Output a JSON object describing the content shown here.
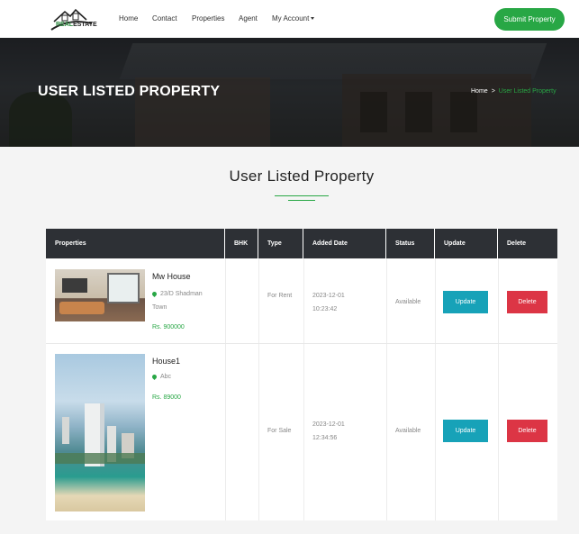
{
  "header": {
    "logo_text_green": "REAL",
    "logo_text_dark": "ESTATE",
    "nav": [
      "Home",
      "Contact",
      "Properties",
      "Agent",
      "My Account"
    ],
    "submit_label": "Submit Property"
  },
  "hero": {
    "title": "USER LISTED PROPERTY",
    "breadcrumb_home": "Home",
    "breadcrumb_sep": ">",
    "breadcrumb_current": "User Listed Property"
  },
  "section": {
    "title": "User Listed Property"
  },
  "table": {
    "columns": [
      "Properties",
      "BHK",
      "Type",
      "Added Date",
      "Status",
      "Update",
      "Delete"
    ],
    "rows": [
      {
        "name": "Mw House",
        "address": "23/D Shadman Town",
        "price": "Rs. 900000",
        "bhk": "",
        "type": "For Rent",
        "added_date": "2023-12-01 10:23:42",
        "status": "Available",
        "update_label": "Update",
        "delete_label": "Delete"
      },
      {
        "name": "House1",
        "address": "Abc",
        "price": "Rs. 89000",
        "bhk": "",
        "type": "For Sale",
        "added_date": "2023-12-01 12:34:56",
        "status": "Available",
        "update_label": "Update",
        "delete_label": "Delete"
      }
    ]
  },
  "colors": {
    "accent": "#28a745",
    "update": "#17a2b8",
    "delete": "#dc3545",
    "table_header": "#2d3035"
  },
  "icons": {
    "location": "map-pin-icon",
    "dropdown": "caret-down-icon"
  }
}
